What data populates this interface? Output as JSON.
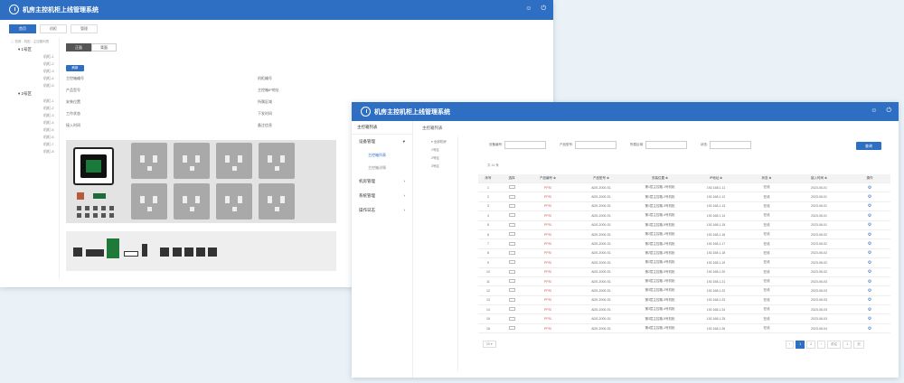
{
  "app": {
    "title": "机房主控机柜上线管理系统",
    "user_icon": "user-icon",
    "power_icon": "power-icon"
  },
  "win1": {
    "tabs": [
      "首页",
      "机柜",
      "管理"
    ],
    "tree_title": "△ 机房 - 机柜 - 主控箱列表",
    "tree_groups": [
      {
        "label": "▾ 1号区",
        "items": [
          "机柜-1",
          "机柜-2",
          "机柜-3",
          "机柜-4",
          "机柜-5"
        ]
      },
      {
        "label": "▾ 2号区",
        "items": [
          "机柜-1",
          "机柜-2",
          "机柜-3",
          "机柜-4",
          "机柜-5",
          "机柜-6",
          "机柜-7",
          "机柜-8"
        ]
      }
    ],
    "segments": [
      "正面",
      "背面"
    ],
    "mini_button": "刷新",
    "info_left": [
      "主控箱编号",
      "产品型号",
      "安装位置",
      "工作状态",
      "接入时间"
    ],
    "info_right": [
      "机柜编号",
      "主控箱IP地址",
      "所属区域",
      "下发时间",
      "备注信息"
    ]
  },
  "win2": {
    "menu_top": "主控箱列表",
    "menu": [
      {
        "label": "设备管理",
        "subs": [
          "主控箱列表",
          "主控箱详情"
        ]
      },
      {
        "label": "机房管理",
        "subs": []
      },
      {
        "label": "系统管理",
        "subs": []
      },
      {
        "label": "操作日志",
        "subs": []
      }
    ],
    "breadcrumb": "主控箱列表",
    "tree": [
      "▾ 全部机房",
      "1号区",
      "2号区",
      "3号区"
    ],
    "filters": [
      "设备编号:",
      "产品型号:",
      "所属区域:",
      "状态:"
    ],
    "query_button": "查询",
    "stats": "共 14 条",
    "headers": [
      "序号",
      "选择",
      "产品编号 ≑",
      "产品型号 ≑",
      "安装位置 ≑",
      "IP地址 ≑",
      "状态 ≑",
      "接入时间 ≑",
      "操作"
    ],
    "rows": [
      [
        "1",
        "",
        "PPSI",
        "ADS-2000-S1",
        "第1层主控箱-1号机柜",
        "192.168.1.11",
        "在线",
        "2023-06-01",
        "⚙"
      ],
      [
        "2",
        "",
        "PPSI",
        "ADS-2000-S1",
        "第1层主控箱-2号机柜",
        "192.168.1.12",
        "在线",
        "2023-06-01",
        "⚙"
      ],
      [
        "3",
        "",
        "PPSI",
        "ADS-2000-S1",
        "第1层主控箱-3号机柜",
        "192.168.1.13",
        "在线",
        "2023-06-01",
        "⚙"
      ],
      [
        "4",
        "",
        "PPSI",
        "ADS-2000-S1",
        "第1层主控箱-4号机柜",
        "192.168.1.14",
        "在线",
        "2023-06-01",
        "⚙"
      ],
      [
        "5",
        "",
        "PPSI",
        "ADS-2000-S1",
        "第1层主控箱-5号机柜",
        "192.168.1.15",
        "在线",
        "2023-06-01",
        "⚙"
      ],
      [
        "6",
        "",
        "PPSI",
        "ADS-2000-S1",
        "第2层主控箱-1号机柜",
        "192.168.1.16",
        "在线",
        "2023-06-02",
        "⚙"
      ],
      [
        "7",
        "",
        "PPSI",
        "ADS-2000-S1",
        "第2层主控箱-2号机柜",
        "192.168.1.17",
        "在线",
        "2023-06-02",
        "⚙"
      ],
      [
        "8",
        "",
        "PPSI",
        "ADS-2000-S1",
        "第2层主控箱-3号机柜",
        "192.168.1.18",
        "在线",
        "2023-06-02",
        "⚙"
      ],
      [
        "9",
        "",
        "PPSI",
        "ADS-2000-S1",
        "第2层主控箱-4号机柜",
        "192.168.1.19",
        "在线",
        "2023-06-02",
        "⚙"
      ],
      [
        "10",
        "",
        "PPSI",
        "ADS-2000-S1",
        "第2层主控箱-5号机柜",
        "192.168.1.20",
        "在线",
        "2023-06-02",
        "⚙"
      ],
      [
        "11",
        "",
        "PPSI",
        "ADS-2000-S1",
        "第3层主控箱-1号机柜",
        "192.168.1.21",
        "在线",
        "2023-06-03",
        "⚙"
      ],
      [
        "12",
        "",
        "PPSI",
        "ADS-2000-S1",
        "第3层主控箱-2号机柜",
        "192.168.1.22",
        "在线",
        "2023-06-03",
        "⚙"
      ],
      [
        "13",
        "",
        "PPSI",
        "ADS-2000-S1",
        "第3层主控箱-3号机柜",
        "192.168.1.23",
        "在线",
        "2023-06-03",
        "⚙"
      ],
      [
        "14",
        "",
        "PPSI",
        "ADS-2000-S1",
        "第3层主控箱-4号机柜",
        "192.168.1.24",
        "在线",
        "2023-06-03",
        "⚙"
      ],
      [
        "15",
        "",
        "PPSI",
        "ADS-2000-S1",
        "第3层主控箱-5号机柜",
        "192.168.1.25",
        "在线",
        "2023-06-03",
        "⚙"
      ],
      [
        "16",
        "",
        "PPSI",
        "ADS-2000-S1",
        "第4层主控箱-1号机柜",
        "192.168.1.26",
        "在线",
        "2023-06-04",
        "⚙"
      ]
    ],
    "page_size": "20 ▾",
    "pager": [
      "‹",
      "1",
      "2",
      "›",
      "前往",
      "1",
      "页"
    ]
  },
  "colors": {
    "primary": "#2f6fc3",
    "socket": "#a9a9a9"
  }
}
